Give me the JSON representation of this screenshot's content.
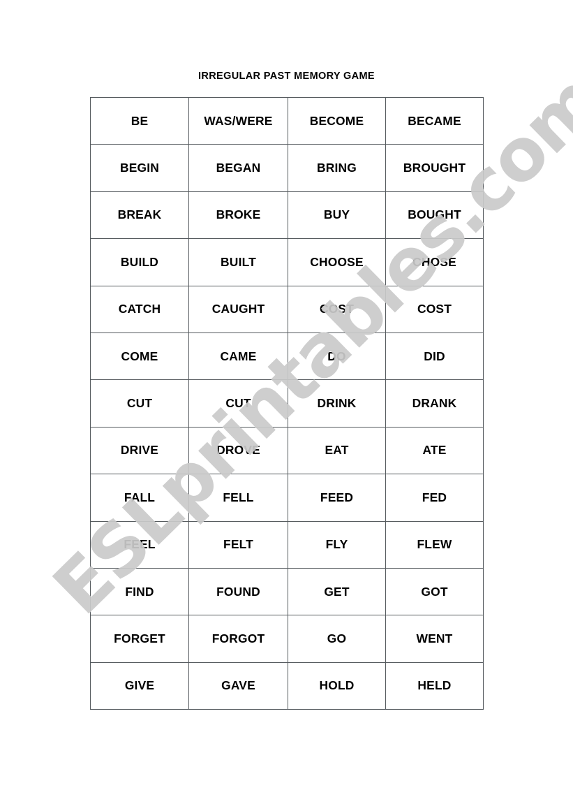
{
  "document": {
    "title": "IRREGULAR PAST MEMORY GAME",
    "watermark": "ESLprintables.com",
    "watermark_color": "#cacaca",
    "page_background": "#ffffff",
    "border_color": "#555a5e",
    "text_color": "#000000"
  },
  "table": {
    "columns": 4,
    "rows": 13,
    "cells": [
      [
        "BE",
        "WAS/WERE",
        "BECOME",
        "BECAME"
      ],
      [
        "BEGIN",
        "BEGAN",
        "BRING",
        "BROUGHT"
      ],
      [
        "BREAK",
        "BROKE",
        "BUY",
        "BOUGHT"
      ],
      [
        "BUILD",
        "BUILT",
        "CHOOSE",
        "CHOSE"
      ],
      [
        "CATCH",
        "CAUGHT",
        "COST",
        "COST"
      ],
      [
        "COME",
        "CAME",
        "DO",
        "DID"
      ],
      [
        "CUT",
        "CUT",
        "DRINK",
        "DRANK"
      ],
      [
        "DRIVE",
        "DROVE",
        "EAT",
        "ATE"
      ],
      [
        "FALL",
        "FELL",
        "FEED",
        "FED"
      ],
      [
        "FEEL",
        "FELT",
        "FLY",
        "FLEW"
      ],
      [
        "FIND",
        "FOUND",
        "GET",
        "GOT"
      ],
      [
        "FORGET",
        "FORGOT",
        "GO",
        "WENT"
      ],
      [
        "GIVE",
        "GAVE",
        "HOLD",
        "HELD"
      ]
    ]
  }
}
